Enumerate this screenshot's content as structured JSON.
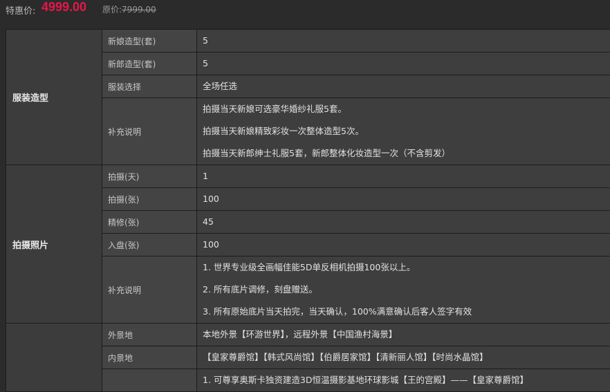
{
  "price": {
    "label": "特惠价:",
    "value": "4999.00",
    "original_label": "原价:",
    "original_value": "7999.00"
  },
  "groups": [
    {
      "name": "服装造型",
      "rows": [
        {
          "key": "新娘造型(套)",
          "lines": [
            "5"
          ]
        },
        {
          "key": "新郎造型(套)",
          "lines": [
            "5"
          ]
        },
        {
          "key": "服装选择",
          "lines": [
            "全场任选"
          ]
        },
        {
          "key": "补充说明",
          "lines": [
            "拍摄当天新娘可选豪华婚纱礼服5套。",
            "拍摄当天新娘精致彩妆一次整体造型5次。",
            "拍摄当天新郎绅士礼服5套，新郎整体化妆造型一次（不含剪发）"
          ]
        }
      ]
    },
    {
      "name": "拍摄照片",
      "rows": [
        {
          "key": "拍摄(天)",
          "lines": [
            "1"
          ]
        },
        {
          "key": "拍摄(张)",
          "lines": [
            "100"
          ]
        },
        {
          "key": "精修(张)",
          "lines": [
            "45"
          ]
        },
        {
          "key": "入盘(张)",
          "lines": [
            "100"
          ]
        },
        {
          "key": "补充说明",
          "lines": [
            "1. 世界专业级全画幅佳能5D单反相机拍摄100张以上。",
            "2. 所有底片调修，刻盘赠送。",
            "3. 所有原始底片当天拍完，当天确认，100%满意确认后客人签字有效"
          ]
        }
      ]
    },
    {
      "name": "",
      "rows": [
        {
          "key": "外景地",
          "lines": [
            "本地外景【环游世界】，远程外景【中国渔村海景】"
          ]
        },
        {
          "key": "内景地",
          "lines": [
            "【皇家尊爵馆】【韩式风尚馆】【伯爵居家馆】【清新丽人馆】【时尚水晶馆】"
          ]
        },
        {
          "key": "",
          "lines": [
            "1.  可尊享奥斯卡独资建造3D恒温摄影基地环球影城【王的宫殿】——【皇家尊爵馆】"
          ]
        }
      ]
    }
  ]
}
